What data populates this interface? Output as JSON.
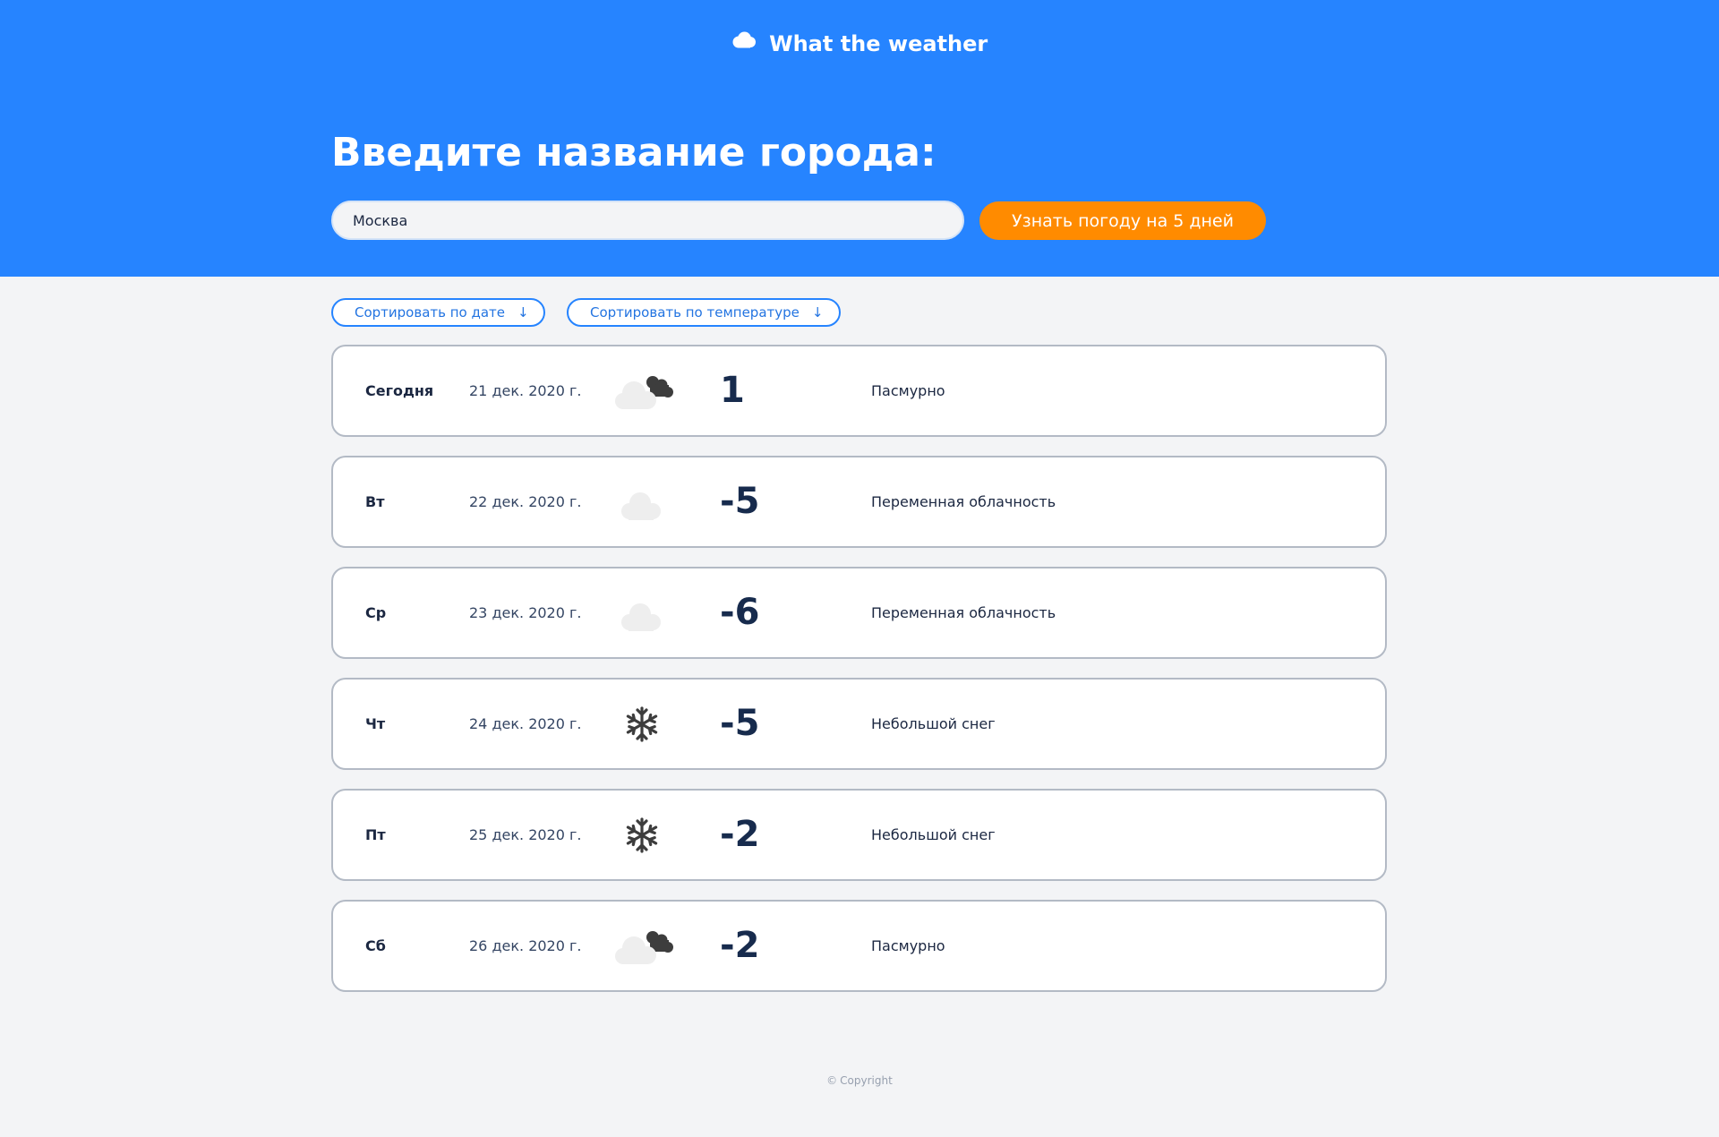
{
  "header": {
    "brand": "What the weather",
    "brand_icon": "cloud-icon",
    "prompt": "Введите название города:",
    "city_value": "Москва",
    "submit_label": "Узнать погоду на 5 дней",
    "background_color": "#2684ff",
    "button_color": "#ff8b00"
  },
  "sort": {
    "by_date_label": "Сортировать по дате",
    "by_temp_label": "Сортировать по температуре",
    "arrow": "↓"
  },
  "forecast": [
    {
      "day": "Сегодня",
      "date": "21 дек. 2020 г.",
      "icon": "overcast-icon",
      "temp": "1",
      "desc": "Пасмурно"
    },
    {
      "day": "Вт",
      "date": "22 дек. 2020 г.",
      "icon": "partly-cloudy-icon",
      "temp": "-5",
      "desc": "Переменная облачность"
    },
    {
      "day": "Ср",
      "date": "23 дек. 2020 г.",
      "icon": "partly-cloudy-icon",
      "temp": "-6",
      "desc": "Переменная облачность"
    },
    {
      "day": "Чт",
      "date": "24 дек. 2020 г.",
      "icon": "snowflake-icon",
      "temp": "-5",
      "desc": "Небольшой снег"
    },
    {
      "day": "Пт",
      "date": "25 дек. 2020 г.",
      "icon": "snowflake-icon",
      "temp": "-2",
      "desc": "Небольшой снег"
    },
    {
      "day": "Сб",
      "date": "26 дек. 2020 г.",
      "icon": "overcast-icon",
      "temp": "-2",
      "desc": "Пасмурно"
    }
  ],
  "footer": {
    "symbol": "©",
    "copyright": "Copyright"
  }
}
